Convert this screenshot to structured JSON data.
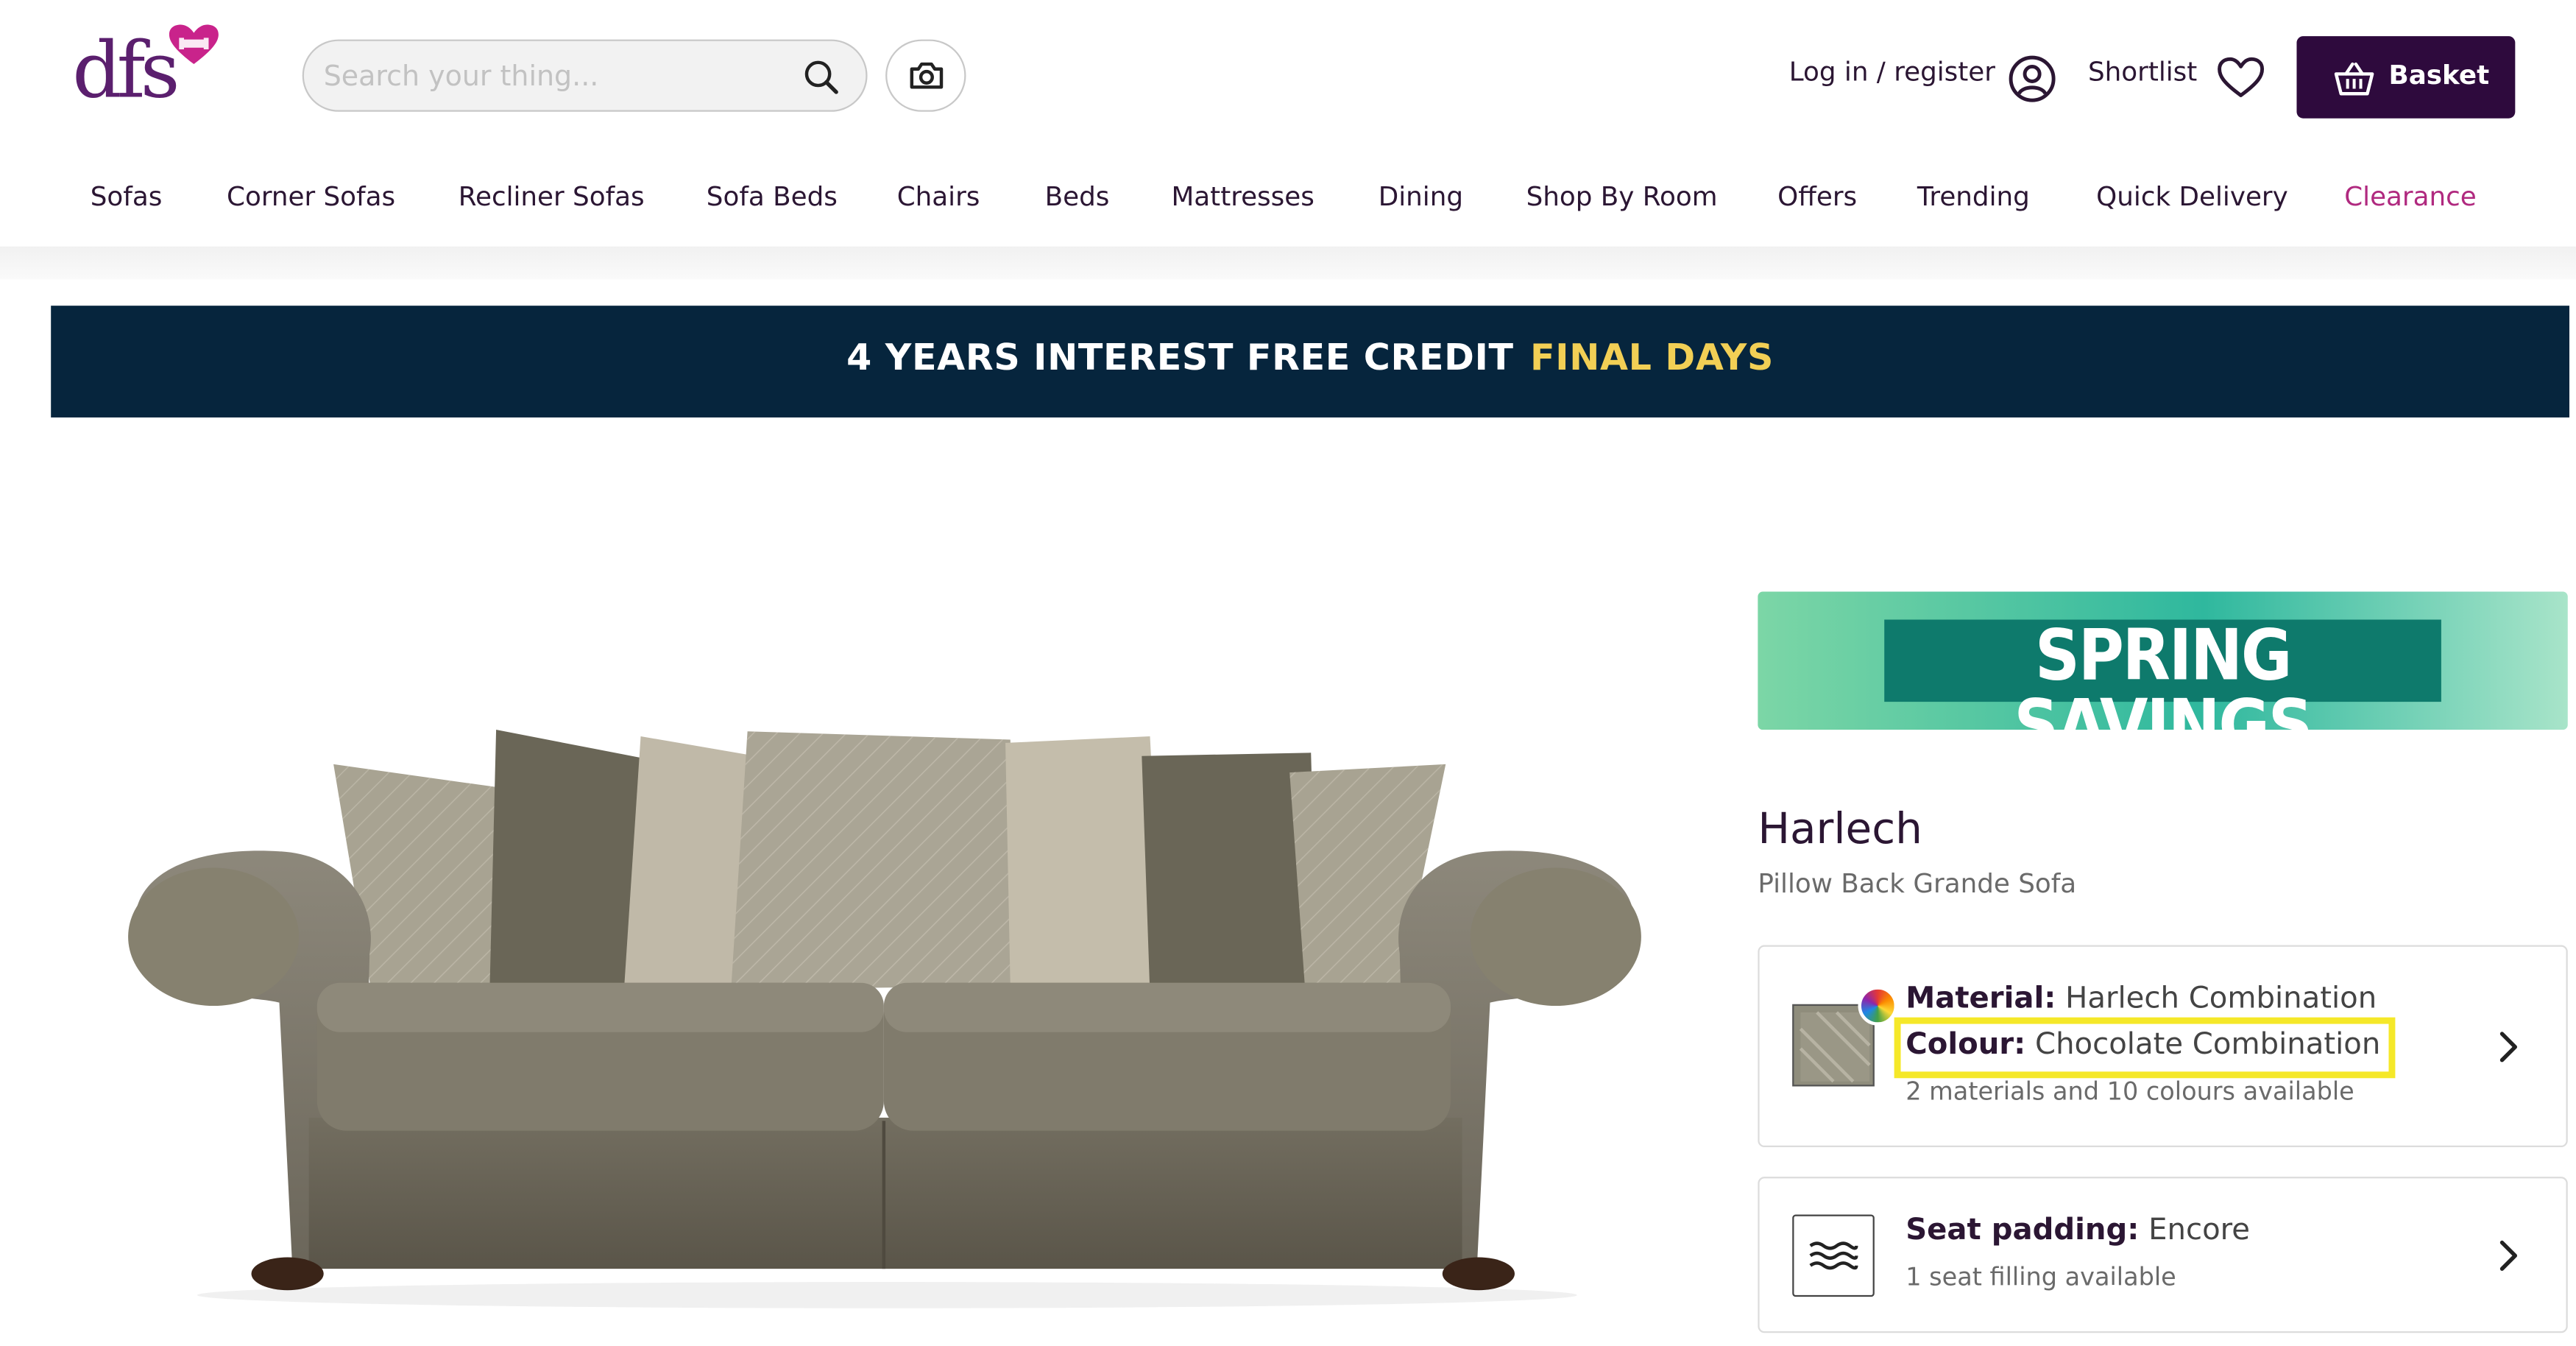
{
  "header": {
    "logo_text": "dfs",
    "search_placeholder": "Search your thing...",
    "login_label": "Log in / register",
    "shortlist_label": "Shortlist",
    "basket_label": "Basket"
  },
  "nav": [
    {
      "label": "Sofas"
    },
    {
      "label": "Corner Sofas"
    },
    {
      "label": "Recliner Sofas"
    },
    {
      "label": "Sofa Beds"
    },
    {
      "label": "Chairs"
    },
    {
      "label": "Beds"
    },
    {
      "label": "Mattresses"
    },
    {
      "label": "Dining"
    },
    {
      "label": "Shop By Room"
    },
    {
      "label": "Offers"
    },
    {
      "label": "Trending"
    },
    {
      "label": "Quick Delivery"
    },
    {
      "label": "Clearance"
    }
  ],
  "banner": {
    "text": "4 YEARS INTEREST FREE CREDIT",
    "highlight": "FINAL DAYS"
  },
  "promo": {
    "text": "SPRING SAVINGS"
  },
  "product": {
    "name": "Harlech",
    "subtitle": "Pillow Back Grande Sofa",
    "material_label": "Material:",
    "material_value": "Harlech Combination",
    "colour_label": "Colour:",
    "colour_value": "Chocolate Combination",
    "availability": "2 materials and 10 colours available",
    "seat_label": "Seat padding:",
    "seat_value": "Encore",
    "seat_availability": "1 seat filling available"
  },
  "colors": {
    "brand_purple": "#5b1f6e",
    "basket_bg": "#2e0a3d",
    "banner_bg": "#06253d",
    "banner_highlight": "#f2cf55",
    "clearance": "#b0297f",
    "highlight_box": "#f5e829"
  },
  "icons": [
    "heart-sofa-logo-icon",
    "search-icon",
    "camera-icon",
    "user-icon",
    "heart-icon",
    "basket-icon",
    "colour-wheel-icon",
    "chevron-right-icon",
    "seat-padding-icon"
  ]
}
